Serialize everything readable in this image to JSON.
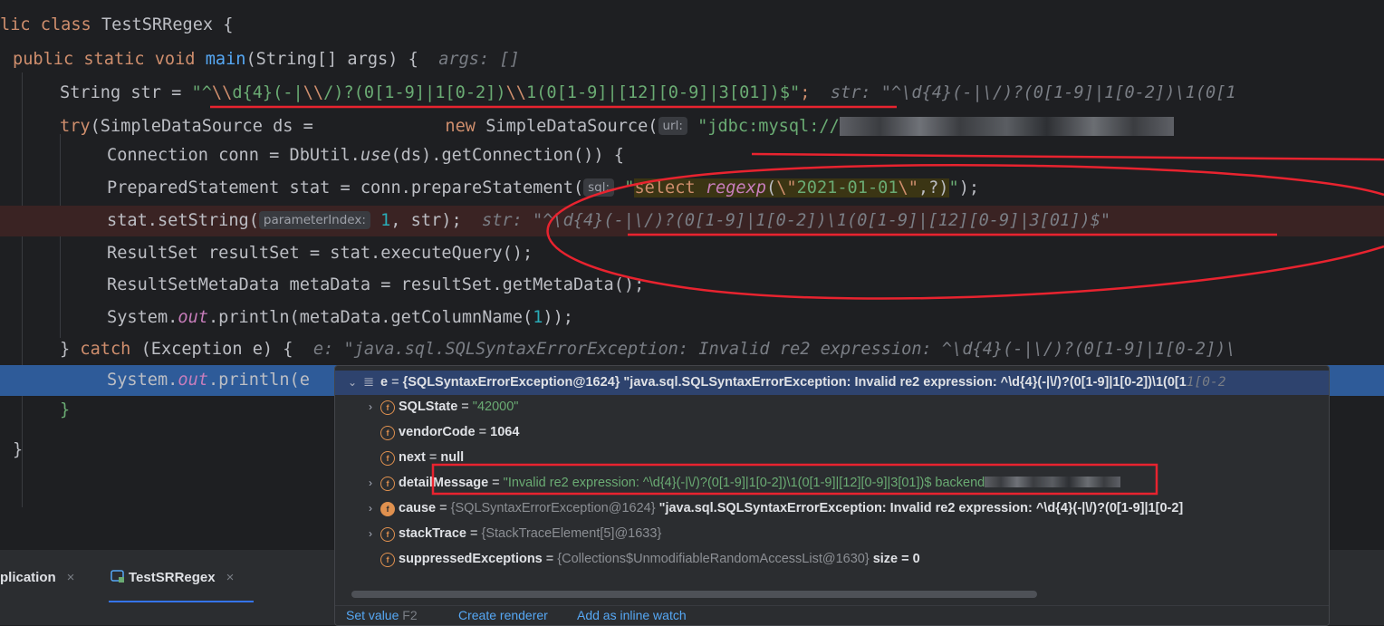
{
  "editor": {
    "l1": {
      "a": "lic ",
      "b": "class",
      "c": " TestSRRegex {"
    },
    "l2": {
      "a": "public static void ",
      "b": "main",
      "c": "(String[] args) {  ",
      "hint": "args: []"
    },
    "l3": {
      "a": "String str = ",
      "s1": "\"^",
      "e1": "\\\\",
      "s2": "d{4}(",
      "e2": "-",
      "s3": "|",
      "e3": "\\\\",
      "s4": "/)?(0[1-9]|1[0-2])",
      "e4": "\\\\",
      "s5": "1(0[1-9]|[12][0-9]|3[01])$\"",
      "c": ";  ",
      "hint": "str: \"^\\d{4}(-|\\/)?(0[1-9]|1[0-2])\\1(0[1"
    },
    "l4": {
      "a": "try",
      "b": "(SimpleDataSource ds =             ",
      "c": "new",
      "d": " SimpleDataSource(",
      "chip": "url:",
      "s": " \"jdbc:mysql://",
      "blur": "xxxxxxxxxxxxxxxxxxxxxxxxxxxxxxxxx"
    },
    "l5": {
      "a": "Connection conn = DbUtil.",
      "b": "use",
      "c": "(ds).getConnection()) {"
    },
    "l6": {
      "a": "PreparedStatement stat = conn.prepareStatement(",
      "chip": "sql:",
      "s1": " \"",
      "sql1": "select ",
      "sql2": "regexp",
      "s2": "(",
      "e1": "\\\"",
      "s3": "2021-01-01",
      "e2": "\\\"",
      "s4": ",?)",
      "s5": "\"",
      "c": ");"
    },
    "l7": {
      "a": "stat.setString(",
      "chip": "parameterIndex:",
      "n": " 1",
      "c": ", str);  ",
      "hint": "str: \"^\\d{4}(-|\\/)?(0[1-9]|1[0-2])\\1(0[1-9]|[12][0-9]|3[01])$\""
    },
    "l8": {
      "a": "ResultSet resultSet = stat.executeQuery();"
    },
    "l9": {
      "a": "ResultSetMetaData metaData = resultSet.getMetaData();"
    },
    "l10": {
      "a": "System.",
      "b": "out",
      "c": ".println(metaData.getColumnName(",
      "n": "1",
      "d": "));"
    },
    "l11": {
      "a": "} ",
      "b": "catch",
      "c": " (Exception e) {  ",
      "hint": "e: \"java.sql.SQLSyntaxErrorException: Invalid re2 expression: ^\\d{4}(-|\\/)?(0[1-9]|1[0-2])\\"
    },
    "l12": {
      "a": "System.",
      "b": "out",
      "c": ".println(e"
    },
    "l13": {
      "a": "}"
    },
    "l14": {
      "a": "}"
    }
  },
  "tabs": [
    {
      "label": "plication"
    },
    {
      "label": "TestSRRegex"
    }
  ],
  "close_glyph": "×",
  "popup": {
    "root": {
      "arrow": "⌄",
      "name": "e",
      "eq": " = ",
      "ref": "{SQLSyntaxErrorException@1624}",
      "val": " \"java.sql.SQLSyntaxErrorException: Invalid re2 expression: ^\\d{4}(-|\\/)?(0[1-9]|1[0-2])\\1(0[1",
      "tail": "1[0-2"
    },
    "fields": [
      {
        "arrow": "›",
        "icon": "f",
        "name": "SQLState",
        "eq": " = ",
        "val": "\"42000\"",
        "kind": "str"
      },
      {
        "arrow": "",
        "icon": "f",
        "name": "vendorCode",
        "eq": " = ",
        "val": "1064",
        "kind": "plain"
      },
      {
        "arrow": "",
        "icon": "f",
        "name": "next",
        "eq": " = ",
        "val": "null",
        "kind": "plain"
      },
      {
        "arrow": "›",
        "icon": "f",
        "name": "detailMessage",
        "eq": " = ",
        "val": "\"Invalid re2 expression: ^\\d{4}(-|\\/)?(0[1-9]|1[0-2])\\1(0[1-9]|[12][0-9]|3[01])$ backend",
        "kind": "str"
      },
      {
        "arrow": "›",
        "icon": "f",
        "name": "cause",
        "eq": " = ",
        "ref": "{SQLSyntaxErrorException@1624}",
        "val": " \"java.sql.SQLSyntaxErrorException: Invalid re2 expression: ^\\d{4}(-|\\/)?(0[1-9]|1[0-2]",
        "kind": "ref"
      },
      {
        "arrow": "›",
        "icon": "f",
        "name": "stackTrace",
        "eq": " = ",
        "ref": "{StackTraceElement[5]@1633}",
        "val": "",
        "kind": "ref"
      },
      {
        "arrow": "",
        "icon": "f",
        "name": "suppressedExceptions",
        "eq": " = ",
        "ref": "{Collections$UnmodifiableRandomAccessList@1630}",
        "val": "  size = 0",
        "kind": "ref"
      }
    ],
    "actions": {
      "set_value": "Set value",
      "set_value_key": "F2",
      "create_renderer": "Create renderer",
      "add_inline_watch": "Add as inline watch"
    }
  },
  "colors": {
    "annotation_red": "#e8232f",
    "accent_blue": "#3574f0"
  }
}
